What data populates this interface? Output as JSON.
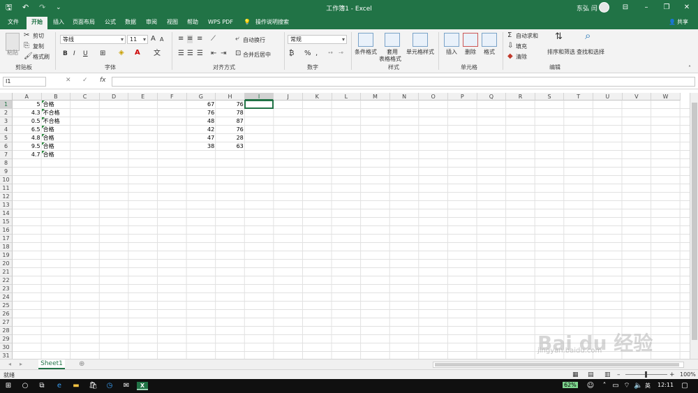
{
  "titlebar": {
    "title": "工作簿1  -  Excel",
    "user": "东弘 闫",
    "colors": {
      "brand": "#217346"
    }
  },
  "tabs": [
    "文件",
    "开始",
    "插入",
    "页面布局",
    "公式",
    "数据",
    "审阅",
    "视图",
    "帮助",
    "WPS PDF"
  ],
  "tell_me": "操作说明搜索",
  "share": "共享",
  "ribbon": {
    "clipboard": {
      "paste": "粘贴",
      "cut": "剪切",
      "copy": "复制",
      "format_painter": "格式刷",
      "label": "剪贴板"
    },
    "font": {
      "name": "等线",
      "size": "11",
      "bold": "B",
      "italic": "I",
      "underline": "U",
      "label": "字体"
    },
    "alignment": {
      "wrap": "自动换行",
      "merge": "合并后居中",
      "label": "对齐方式"
    },
    "number": {
      "format": "常规",
      "percent": "%",
      "comma": ",",
      "label": "数字"
    },
    "styles": {
      "conditional": "条件格式",
      "table": "套用",
      "table2": "表格格式",
      "cell_styles": "单元格样式",
      "label": "样式"
    },
    "cells": {
      "insert": "插入",
      "delete": "删除",
      "format": "格式",
      "label": "单元格"
    },
    "editing": {
      "autosum": "自动求和",
      "fill": "填充",
      "clear": "清除",
      "sort": "排序和筛选",
      "find": "查找和选择",
      "label": "编辑"
    }
  },
  "formula_bar": {
    "name_box": "I1",
    "fx": "fx",
    "value": ""
  },
  "columns": [
    "A",
    "B",
    "C",
    "D",
    "E",
    "F",
    "G",
    "H",
    "I",
    "J",
    "K",
    "L",
    "M",
    "N",
    "O",
    "P",
    "Q",
    "R",
    "S",
    "T",
    "U",
    "V",
    "W"
  ],
  "rows": [
    "1",
    "2",
    "3",
    "4",
    "5",
    "6",
    "7",
    "8",
    "9",
    "10",
    "11",
    "12",
    "13",
    "14",
    "15",
    "16",
    "17",
    "18",
    "19",
    "20",
    "21",
    "22",
    "23",
    "24",
    "25",
    "26",
    "27",
    "28",
    "29",
    "30",
    "31"
  ],
  "cells": {
    "A": [
      "5",
      "4.3",
      "0.5",
      "6.5",
      "4.8",
      "9.5",
      "4.7"
    ],
    "B": [
      "合格",
      "不合格",
      "不合格",
      "合格",
      "合格",
      "合格",
      "合格"
    ],
    "G": [
      "67",
      "76",
      "48",
      "42",
      "47",
      "38"
    ],
    "H": [
      "76",
      "78",
      "87",
      "76",
      "28",
      "63"
    ]
  },
  "sheet_tab": "Sheet1",
  "status": {
    "ready": "就绪",
    "zoom": "100%"
  },
  "taskbar": {
    "battery": "62%",
    "ime": "英",
    "time": "12:11"
  },
  "watermark": {
    "brand": "Bai du 经验",
    "url": "jingyan.baidu.com"
  }
}
